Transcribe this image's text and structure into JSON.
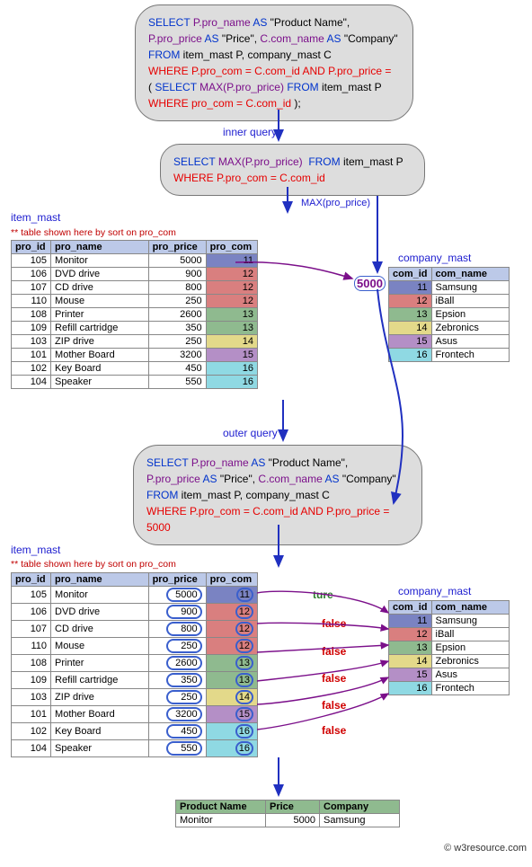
{
  "topQuery": {
    "l1a": "SELECT",
    "l1b": "P.pro_name",
    "l1c": "AS",
    "l1d": "\"Product Name\",",
    "l2a": "P.pro_price",
    "l2b": "AS",
    "l2c": "\"Price\",",
    "l2d": "C.com_name",
    "l2e": "AS",
    "l2f": "\"Company\"",
    "l3a": "FROM",
    "l3b": "item_mast P, company_mast C",
    "l4a": "WHERE P.pro_com = C.com_id  AND P.pro_price =",
    "l5a": "(",
    "l5b": "SELECT",
    "l5c": "MAX(P.pro_price)",
    "l5d": "FROM",
    "l5e": "item_mast P",
    "l6a": "WHERE pro_com = C.com_id",
    "l6b": ");"
  },
  "labels": {
    "innerQuery": "inner query",
    "outerQuery": "outer query",
    "maxPro": "MAX(pro_price)",
    "itemMast": "item_mast",
    "companyMast": "company_mast",
    "note": "** table shown here  by sort on pro_com"
  },
  "innerQuery": {
    "l1a": "SELECT",
    "l1b": "MAX(P.pro_price)",
    "l1c": "FROM",
    "l1d": "item_mast P",
    "l2a": "WHERE P.pro_com = C.com_id"
  },
  "value5000": "5000",
  "outerQuery": {
    "l1a": "SELECT",
    "l1b": "P.pro_name",
    "l1c": "AS",
    "l1d": "\"Product Name\",",
    "l2a": "P.pro_price",
    "l2b": "AS",
    "l2c": "\"Price\",",
    "l2d": "C.com_name",
    "l2e": "AS",
    "l2f": "\"Company\"",
    "l3a": "FROM",
    "l3b": "item_mast P, company_mast C",
    "l4a": "WHERE P.pro_com = C.com_id  AND P.pro_price = 5000"
  },
  "itemHeaders": {
    "c1": "pro_id",
    "c2": "pro_name",
    "c3": "pro_price",
    "c4": "pro_com"
  },
  "itemRows": [
    {
      "id": "105",
      "name": "Monitor",
      "price": "5000",
      "com": "11",
      "cls": "g11"
    },
    {
      "id": "106",
      "name": "DVD drive",
      "price": "900",
      "com": "12",
      "cls": "g12"
    },
    {
      "id": "107",
      "name": "CD drive",
      "price": "800",
      "com": "12",
      "cls": "g12"
    },
    {
      "id": "110",
      "name": "Mouse",
      "price": "250",
      "com": "12",
      "cls": "g12"
    },
    {
      "id": "108",
      "name": "Printer",
      "price": "2600",
      "com": "13",
      "cls": "g13"
    },
    {
      "id": "109",
      "name": "Refill cartridge",
      "price": "350",
      "com": "13",
      "cls": "g13"
    },
    {
      "id": "103",
      "name": "ZIP drive",
      "price": "250",
      "com": "14",
      "cls": "g14"
    },
    {
      "id": "101",
      "name": "Mother Board",
      "price": "3200",
      "com": "15",
      "cls": "g15"
    },
    {
      "id": "102",
      "name": "Key Board",
      "price": "450",
      "com": "16",
      "cls": "g16"
    },
    {
      "id": "104",
      "name": "Speaker",
      "price": "550",
      "com": "16",
      "cls": "g16"
    }
  ],
  "compHeaders": {
    "c1": "com_id",
    "c2": "com_name"
  },
  "compRows": [
    {
      "id": "11",
      "name": "Samsung",
      "cls": "g11"
    },
    {
      "id": "12",
      "name": "iBall",
      "cls": "g12"
    },
    {
      "id": "13",
      "name": "Epsion",
      "cls": "g13"
    },
    {
      "id": "14",
      "name": "Zebronics",
      "cls": "g14"
    },
    {
      "id": "15",
      "name": "Asus",
      "cls": "g15"
    },
    {
      "id": "16",
      "name": "Frontech",
      "cls": "g16"
    }
  ],
  "tf": {
    "true": "ture",
    "false": "false"
  },
  "resultHeaders": {
    "c1": "Product Name",
    "c2": "Price",
    "c3": "Company"
  },
  "resultRow": {
    "name": "Monitor",
    "price": "5000",
    "company": "Samsung"
  },
  "footer": "© w3resource.com"
}
